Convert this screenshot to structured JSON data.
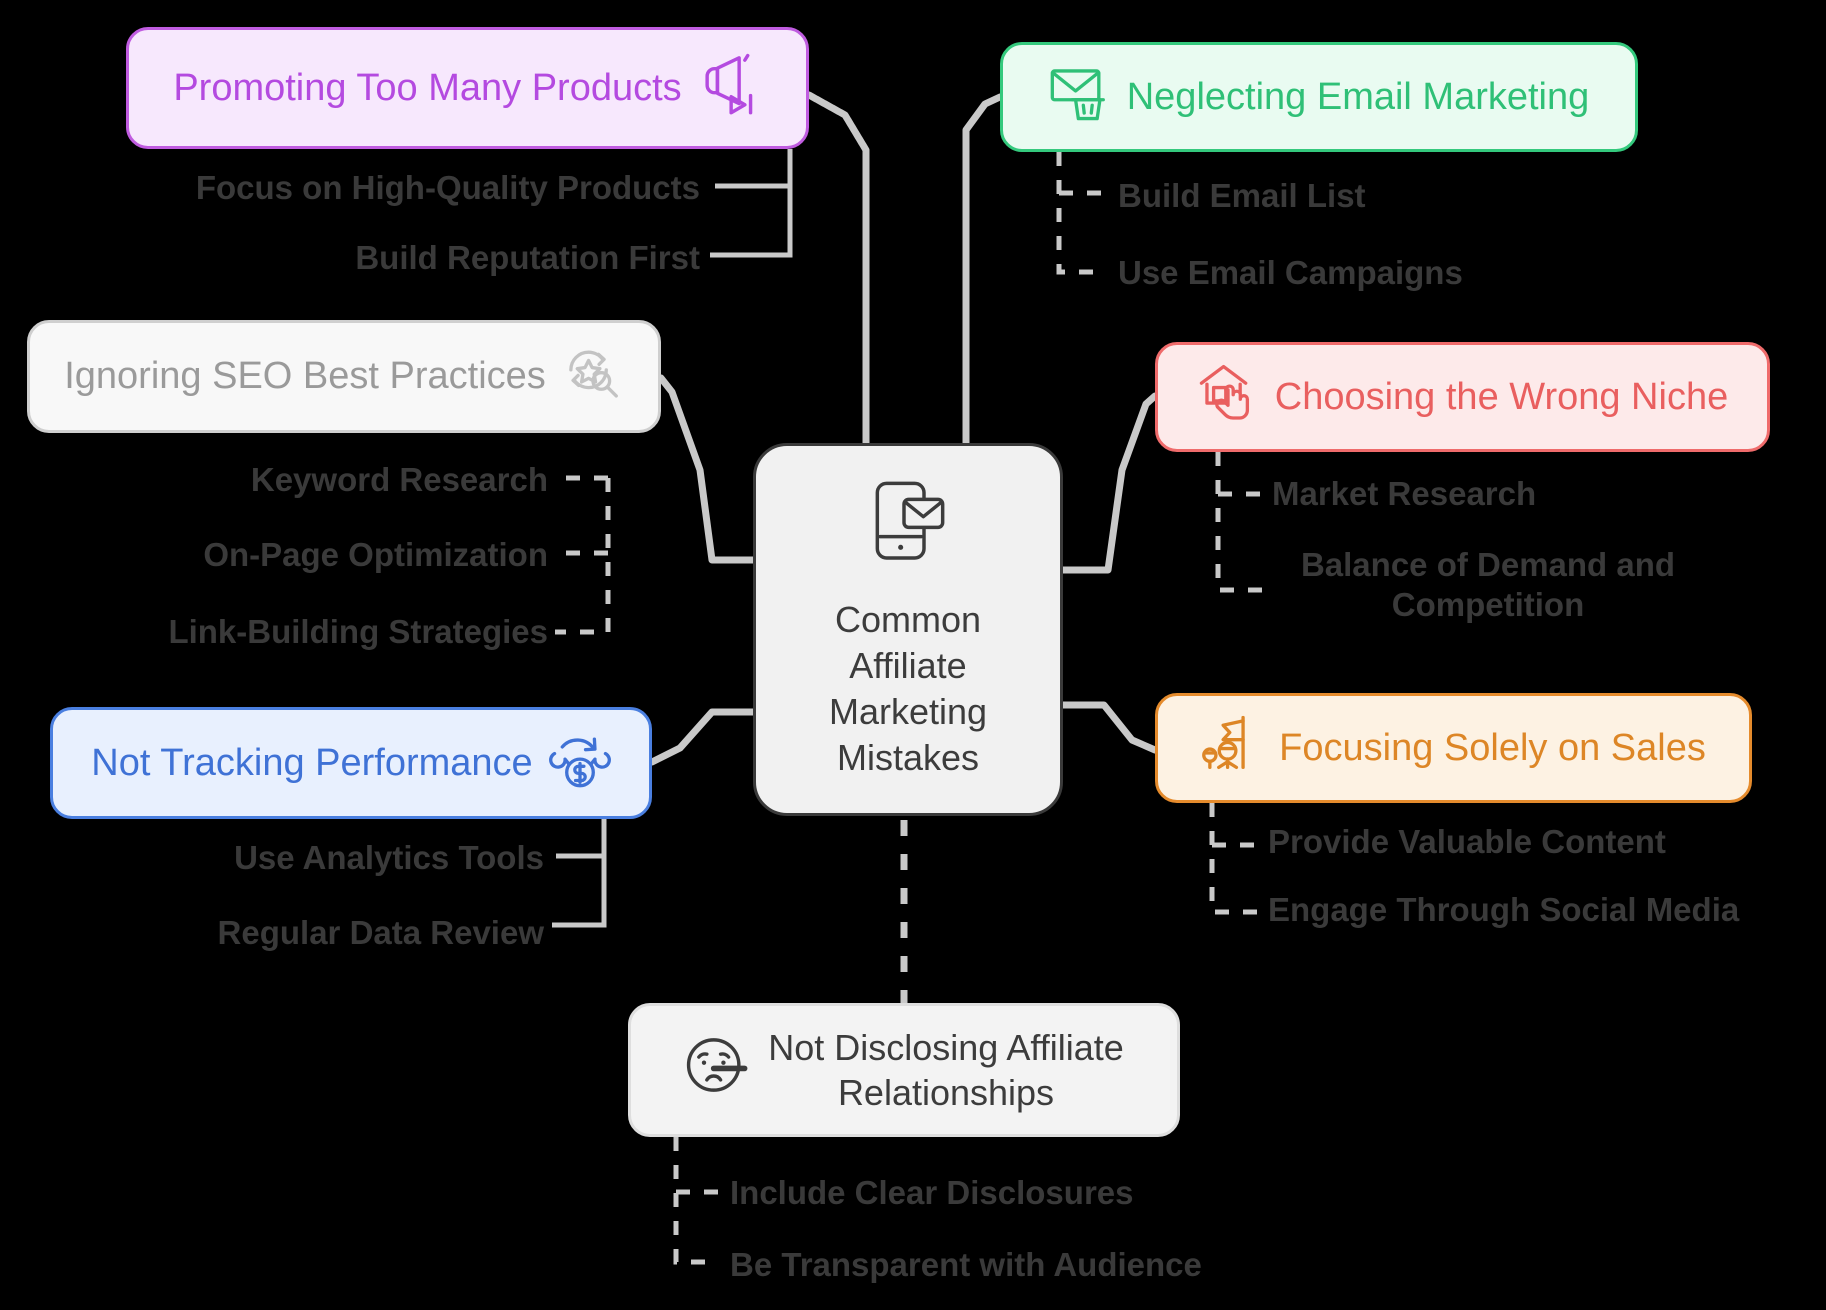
{
  "diagram": {
    "type": "mindmap",
    "background": "#000000",
    "center": {
      "label": "Common\nAffiliate\nMarketing\nMistakes",
      "icon": "mobile-email-icon",
      "background": "#f1f1f1",
      "border": "#3a3a3a",
      "text_color": "#3c3c3c"
    },
    "branches": [
      {
        "id": "promoting",
        "label": "Promoting Too Many Products",
        "icon": "megaphone-icon",
        "accent": "#b44ae0",
        "background": "#f7e8fd",
        "border": "#c05ce0",
        "children": [
          {
            "label": "Focus on High-Quality Products"
          },
          {
            "label": "Build Reputation First"
          }
        ]
      },
      {
        "id": "email",
        "label": "Neglecting Email Marketing",
        "icon": "email-trash-icon",
        "accent": "#2fc077",
        "background": "#e9fbf1",
        "border": "#34c97d",
        "children": [
          {
            "label": "Build Email List"
          },
          {
            "label": "Use Email Campaigns"
          }
        ]
      },
      {
        "id": "seo",
        "label": "Ignoring SEO Best Practices",
        "icon": "seo-search-star-icon",
        "accent": "#9a9a9a",
        "background": "#f8f8f8",
        "border": "#cfcfcf",
        "children": [
          {
            "label": "Keyword Research"
          },
          {
            "label": "On-Page Optimization"
          },
          {
            "label": "Link-Building Strategies"
          }
        ]
      },
      {
        "id": "niche",
        "label": "Choosing the Wrong Niche",
        "icon": "house-hand-icon",
        "accent": "#e95f5f",
        "background": "#fdeaea",
        "border": "#ef6b6b",
        "children": [
          {
            "label": "Market Research"
          },
          {
            "label": "Balance of Demand and\nCompetition"
          }
        ]
      },
      {
        "id": "tracking",
        "label": "Not Tracking Performance",
        "icon": "money-cycle-icon",
        "accent": "#3f72d6",
        "background": "#e8f0fe",
        "border": "#4a7fe0",
        "children": [
          {
            "label": "Use Analytics Tools"
          },
          {
            "label": "Regular Data Review"
          }
        ]
      },
      {
        "id": "sales",
        "label": "Focusing Solely on Sales",
        "icon": "people-flag-icon",
        "accent": "#dd8626",
        "background": "#fdf2e3",
        "border": "#e58b2c",
        "children": [
          {
            "label": "Provide Valuable Content"
          },
          {
            "label": "Engage Through Social Media"
          }
        ]
      },
      {
        "id": "disclose",
        "label": "Not Disclosing Affiliate\nRelationships",
        "icon": "lying-face-icon",
        "accent": "#3c3c3c",
        "background": "#f3f3f3",
        "border": "#dedede",
        "children": [
          {
            "label": "Include Clear Disclosures"
          },
          {
            "label": "Be Transparent with Audience"
          }
        ]
      }
    ],
    "connector_color": "#c9c9c9",
    "leaf_text_color": "#3a3a3a"
  }
}
